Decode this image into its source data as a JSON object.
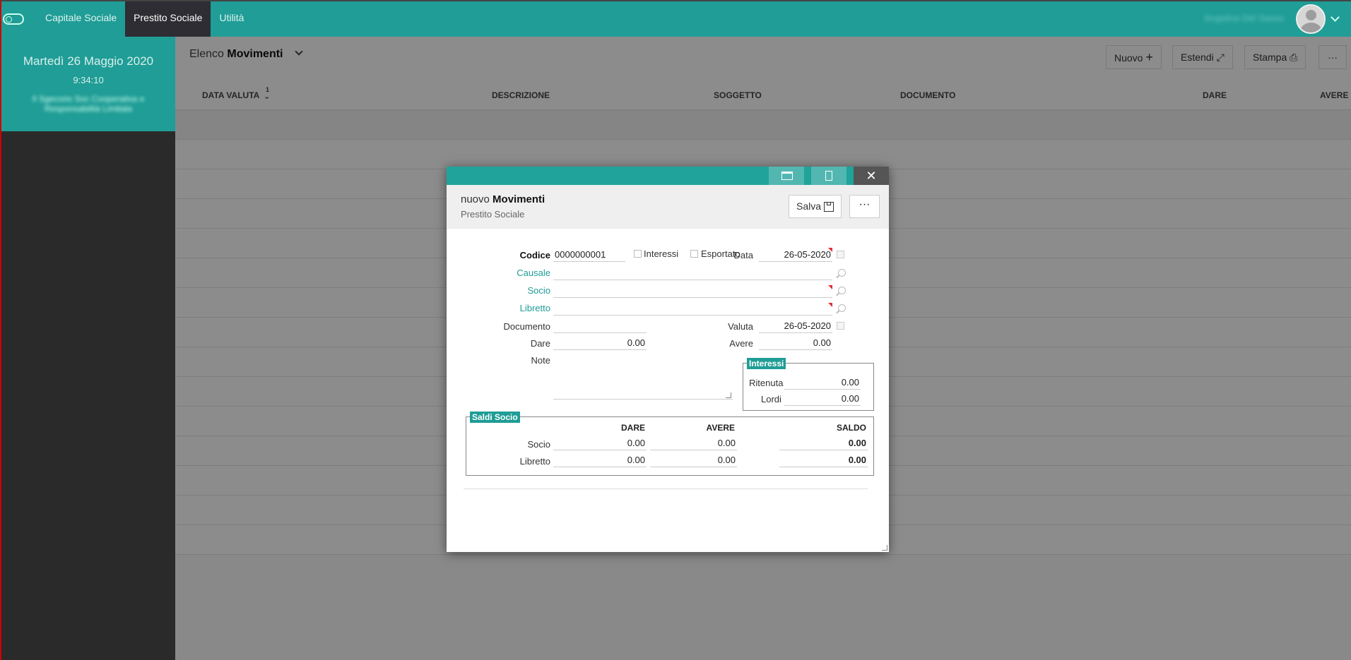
{
  "topnav": {
    "items": [
      "Capitale Sociale",
      "Prestito Sociale",
      "Utilità"
    ],
    "active": "Prestito Sociale"
  },
  "user": {
    "name": "Angelica Del Sasso"
  },
  "sidebar": {
    "date": "Martedì 26 Maggio 2020",
    "time": "9:34:10",
    "org": "Il Sgecorio Soc Cooperativa e Responsabilità Limitata"
  },
  "list": {
    "title_prefix": "Elenco",
    "title_main": "Movimenti"
  },
  "toolbar": {
    "nuovo": "Nuovo",
    "estendi": "Estendi",
    "stampa": "Stampa",
    "more": "···"
  },
  "columns": {
    "data_valuta": "DATA VALUTA",
    "sort_index": "1",
    "descrizione": "DESCRIZIONE",
    "soggetto": "SOGGETTO",
    "documento": "DOCUMENTO",
    "dare": "DARE",
    "avere": "AVERE"
  },
  "dialog": {
    "title_prefix": "nuovo",
    "title_main": "Movimenti",
    "subtitle": "Prestito Sociale",
    "save_label": "Salva",
    "more_label": "···",
    "close": "✕",
    "form": {
      "codice_label": "Codice",
      "codice_value": "0000000001",
      "interessi_cb": "Interessi",
      "esportato_cb": "Esportato",
      "data_label": "Data",
      "data_value": "26-05-2020",
      "causale_label": "Causale",
      "socio_label": "Socio",
      "libretto_label": "Libretto",
      "documento_label": "Documento",
      "valuta_label": "Valuta",
      "valuta_value": "26-05-2020",
      "dare_label": "Dare",
      "dare_value": "0.00",
      "avere_label": "Avere",
      "avere_value": "0.00",
      "note_label": "Note"
    },
    "interessi_box": {
      "title": "Interessi",
      "ritenuta_label": "Ritenuta",
      "ritenuta_value": "0.00",
      "lordi_label": "Lordi",
      "lordi_value": "0.00"
    },
    "saldi_box": {
      "title": "Saldi Socio",
      "headers": [
        "DARE",
        "AVERE",
        "SALDO"
      ],
      "rows": [
        {
          "label": "Socio",
          "dare": "0.00",
          "avere": "0.00",
          "saldo": "0.00"
        },
        {
          "label": "Libretto",
          "dare": "0.00",
          "avere": "0.00",
          "saldo": "0.00"
        }
      ]
    }
  }
}
